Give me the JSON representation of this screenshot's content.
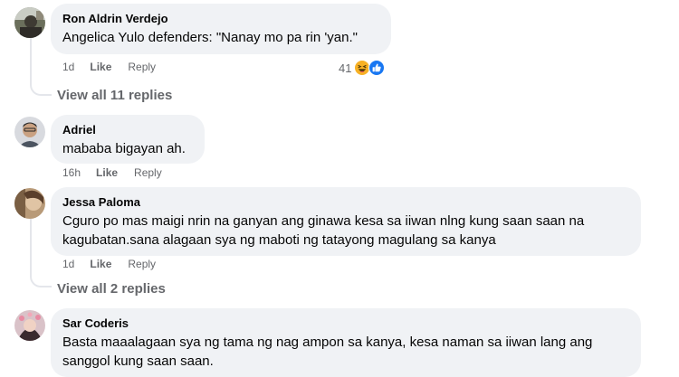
{
  "comments": [
    {
      "author": "Ron Aldrin Verdejo",
      "text": "Angelica Yulo defenders: \"Nanay mo pa rin 'yan.\"",
      "time": "1d",
      "like": "Like",
      "reply": "Reply",
      "reaction_count": "41",
      "reaction_icons": [
        "haha-icon",
        "like-icon"
      ],
      "view_replies": "View all 11 replies"
    },
    {
      "author": "Adriel",
      "text": "mababa bigayan ah.",
      "time": "16h",
      "like": "Like",
      "reply": "Reply"
    },
    {
      "author": "Jessa Paloma",
      "text": "Cguro po mas maigi nrin na ganyan ang ginawa kesa sa iiwan nlng kung saan saan na kagubatan.sana alagaan sya ng maboti ng tatayong magulang sa kanya",
      "time": "1d",
      "like": "Like",
      "reply": "Reply",
      "view_replies": "View all 2 replies"
    },
    {
      "author": "Sar Coderis",
      "text": "Basta maaalagaan sya ng tama ng nag ampon sa kanya, kesa naman sa iiwan lang ang sanggol kung saan saan."
    }
  ],
  "colors": {
    "bubble": "#f0f2f5",
    "meta_text": "#65676b",
    "text": "#050505",
    "like_blue": "#1877f2",
    "haha_yellow": "#f7b125"
  }
}
